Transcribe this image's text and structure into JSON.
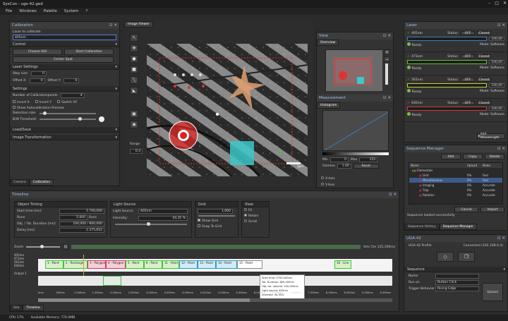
{
  "app": {
    "title": "SysCon - ugs-42.ged"
  },
  "menu": [
    "File",
    "Windows",
    "Palette",
    "System",
    "?"
  ],
  "calibration": {
    "title": "Calibration",
    "laser_label": "Laser to calibrate:",
    "laser_value": "405nm",
    "control_section": "Control",
    "choose_aoi": "Choose AOI",
    "start_calibration": "Start Calibration",
    "center_spot": "Center Spot",
    "laser_settings": "Laser Settings",
    "step_size_label": "Step size:",
    "step_size": "0",
    "offset_x_label": "Offset X:",
    "offset_x": "0",
    "offset_y_label": "Offset Y:",
    "offset_y": "0",
    "settings": "Settings",
    "num_calib_label": "Number of Calibrationpoints",
    "num_calib": "4",
    "invert_x": "Invert X",
    "invert_y": "Invert Y",
    "switch_xy": "Switch XY",
    "show_preview": "Show Autocalibration Preview",
    "detection_size": "Detection size:",
    "bw_threshold": "B/W Threshold:",
    "load_save": "Load/Save",
    "image_transformation": "Image Transformation",
    "tabs": [
      "Camera",
      "Calibration"
    ]
  },
  "image_viewer": {
    "tab": "Image Viewer",
    "range_label": "Range",
    "range_value": "0.3",
    "scale_label": "1µm"
  },
  "view_panel": {
    "title": "View",
    "overview_tab": "Overview",
    "measurement_title": "Measurement",
    "histogram_tab": "Histogram",
    "min_label": "Min",
    "min_value": "0",
    "max_label": "Max",
    "max_value": "255",
    "gamma_label": "Gamma",
    "gamma_value": "1.00",
    "reset": "Reset",
    "x_axis": "X-Axis",
    "y_axis": "Y-Axis"
  },
  "laser": {
    "title": "Laser",
    "status_label": "Status:",
    "off": "OFF",
    "closed": "Closed",
    "ready": "Ready",
    "mode_label": "Mode: Software",
    "add_wavelength": "Add Wavelength",
    "items": [
      {
        "name": "405nm",
        "power": "100,00",
        "color": "#3a7ebf"
      },
      {
        "name": "473nm",
        "power": "100,00",
        "color": "#5fbf3a"
      },
      {
        "name": "561nm",
        "power": "100,00",
        "color": "#cfcf3a"
      },
      {
        "name": "640nm",
        "power": "100,00",
        "color": "#cf3a3a"
      }
    ]
  },
  "sequence_manager": {
    "title": "Sequence Manager",
    "add": "Add",
    "copy": "Copy",
    "delete": "Delete",
    "columns": [
      "Name",
      "Upload",
      "Mode"
    ],
    "rows": [
      {
        "name": "Elementals",
        "upload": "",
        "mode": ""
      },
      {
        "name": "Grid",
        "upload": "0%",
        "mode": "Fast"
      },
      {
        "name": "Miscellaneous",
        "upload": "0%",
        "mode": "Fast"
      },
      {
        "name": "Imaging",
        "upload": "0%",
        "mode": "Accurate"
      },
      {
        "name": "Trap",
        "upload": "0%",
        "mode": "Accurate"
      },
      {
        "name": "Rotation",
        "upload": "0%",
        "mode": "Accurate"
      }
    ],
    "cancel": "Cancel",
    "import": "Import",
    "status": "Sequence loaded successfully",
    "tabs": [
      "Sequence History",
      "Sequence Manager"
    ]
  },
  "uga": {
    "title": "UGA-42",
    "profile": "UGA-42 Profile",
    "connected": "Connected (192.168.0.4)",
    "sequence_section": "Sequence",
    "name_label": "Name",
    "name_value": "",
    "run_on_label": "Run on",
    "run_on_value": "Button Click",
    "trigger_label": "Trigger Behavior",
    "trigger_value": "Rising Edge",
    "upload": "Upload"
  },
  "timeline": {
    "title": "Timeline",
    "object_timing": "Object Timing",
    "start_time_label": "Start time [ms]:",
    "start_time": "5.700,000",
    "runs_label": "Runs:",
    "runs": "5.000",
    "runs_unit": "Runs",
    "obj_duration_label": "Obj. / Tot. Duration [ms]:",
    "obj_duration": "100,000 / 800,000",
    "delay_label": "Delay [ms]:",
    "delay": "2.375,652",
    "light_source": "Light Source",
    "light_source_label": "Light Source:",
    "light_source_value": "405nm",
    "intensity_label": "Intensity:",
    "intensity_value": "44,35 %",
    "grid_title": "Grid",
    "grid_value": "1,000",
    "show_grid": "Show Grid",
    "snap_to_grid": "Snap To Grid",
    "view_title": "View",
    "view_options": [
      "Fit",
      "Retain",
      "Scroll"
    ],
    "zoom_label": "Zoom",
    "time_range": "0ms 5m 155,100ms",
    "rows": [
      "405nm",
      "473nm",
      "561nm",
      "640nm",
      "Output 1"
    ],
    "segments": [
      "1 - Point",
      "2 - Rectangle",
      "3 - Polygon",
      "4 - Polygon",
      "5 - Point",
      "6 - Point",
      "11 - Point",
      "12 - Point",
      "13 - Point",
      "14 - Point",
      "15 - Point",
      "16 - Line"
    ],
    "tooltip": [
      "Start time: 5700,000ms",
      "Tot. Duration: 800,000ms",
      "Obj. tot. volume: 100,000ms",
      "Light source: 405nm",
      "Intensity: 44,35%"
    ],
    "ticks": [
      "0ms",
      "500ms",
      "1.000ms",
      "1.500ms",
      "2.000ms",
      "2.500ms",
      "3.000ms",
      "3.500ms",
      "4.000ms",
      "4.500ms",
      "5.000ms",
      "5.500ms",
      "6.000ms",
      "6.500ms",
      "7.000ms",
      "7.500ms",
      "8.000ms",
      "8.500ms",
      "9.000ms",
      "9.500ms"
    ],
    "tabs": [
      "Sea",
      "Timeline"
    ]
  },
  "status": {
    "cpu": "CPU 17%",
    "memory": "Available Memory: 770.0MB"
  }
}
